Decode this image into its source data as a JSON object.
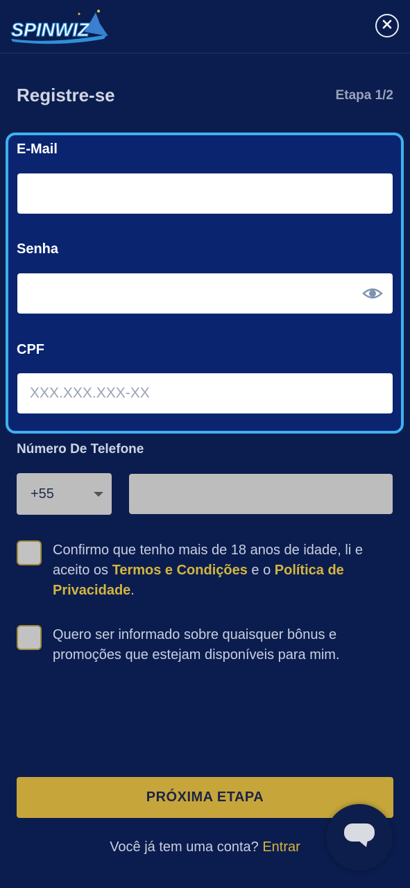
{
  "brand": {
    "logo_text": "SPINWIZ"
  },
  "header": {
    "close_icon": "close-icon"
  },
  "form": {
    "title": "Registre-se",
    "step": "Etapa 1/2",
    "email": {
      "label": "E-Mail",
      "value": "",
      "placeholder": ""
    },
    "password": {
      "label": "Senha",
      "value": "",
      "placeholder": "",
      "toggle_icon": "eye-icon"
    },
    "cpf": {
      "label": "CPF",
      "value": "",
      "placeholder": "XXX.XXX.XXX-XX"
    },
    "phone": {
      "label": "Número De Telefone",
      "country_code": "+55",
      "value": ""
    },
    "terms": {
      "text_1": "Confirmo que tenho mais de 18 anos de idade, li e aceito os ",
      "terms_link": "Termos e Condições",
      "text_2": " e o ",
      "privacy_link": "Política de Privacidade",
      "text_3": ".",
      "checked": false
    },
    "promo": {
      "text": "Quero ser informado sobre quaisquer bônus e promoções que estejam disponíveis para mim.",
      "checked": false
    },
    "next_button": "PRÓXIMA ETAPA",
    "footer_text": "Você já tem uma conta? ",
    "footer_link": "Entrar"
  },
  "chat": {
    "icon": "chat-bubble-icon"
  },
  "colors": {
    "background": "#0b1d4f",
    "highlight_border": "#3fb0f0",
    "accent_gold": "#c6a63a",
    "link_gold": "#d4b53e"
  }
}
